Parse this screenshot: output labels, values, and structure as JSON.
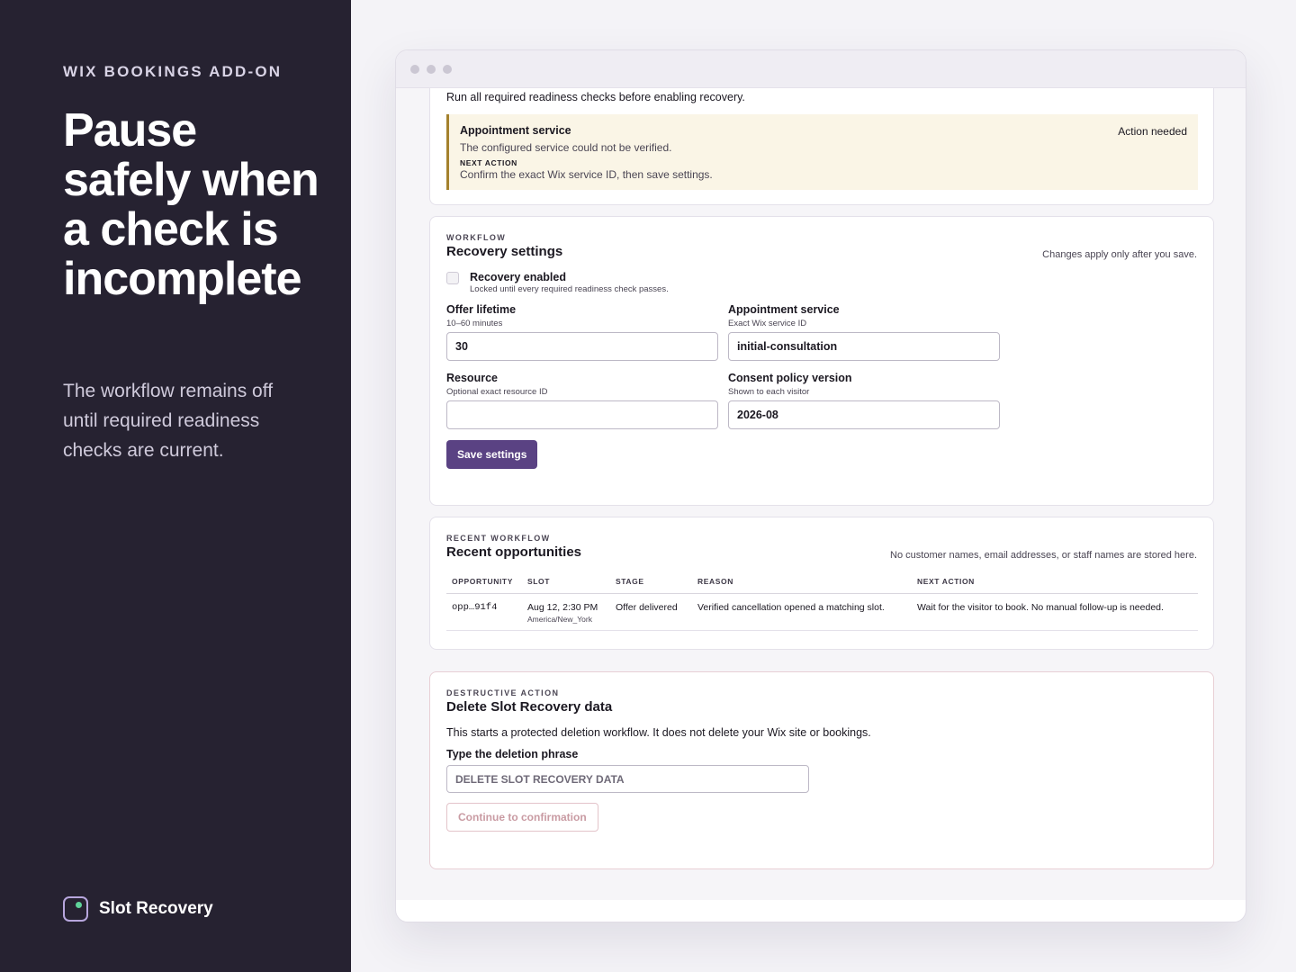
{
  "hero": {
    "eyebrow": "WIX BOOKINGS ADD-ON",
    "headline": "Pause safely when a check is incomplete",
    "subtext": "The workflow remains off until required readiness checks are current.",
    "brand_name": "Slot Recovery"
  },
  "readiness": {
    "intro": "Run all required readiness checks before enabling recovery.",
    "notice": {
      "title": "Appointment service",
      "status": "Action needed",
      "description": "The configured service could not be verified.",
      "next_label": "NEXT ACTION",
      "next_action": "Confirm the exact Wix service ID, then save settings."
    }
  },
  "settings": {
    "kicker": "WORKFLOW",
    "title": "Recovery settings",
    "note": "Changes apply only after you save.",
    "recovery_label": "Recovery enabled",
    "recovery_hint": "Locked until every required readiness check passes.",
    "offer_label": "Offer lifetime",
    "offer_hint": "10–60 minutes",
    "offer_value": "30",
    "appt_label": "Appointment service",
    "appt_hint": "Exact Wix service ID",
    "appt_value": "initial-consultation",
    "resource_label": "Resource",
    "resource_hint": "Optional exact resource ID",
    "resource_value": "",
    "consent_label": "Consent policy version",
    "consent_hint": "Shown to each visitor",
    "consent_value": "2026-08",
    "save_label": "Save settings"
  },
  "recent": {
    "kicker": "RECENT WORKFLOW",
    "title": "Recent opportunities",
    "note": "No customer names, email addresses, or staff names are stored here.",
    "columns": [
      "OPPORTUNITY",
      "SLOT",
      "STAGE",
      "REASON",
      "NEXT ACTION"
    ],
    "rows": [
      {
        "opportunity": "opp…91f4",
        "slot": "Aug 12, 2:30 PM",
        "timezone": "America/New_York",
        "stage": "Offer delivered",
        "reason": "Verified cancellation opened a matching slot.",
        "next_action": "Wait for the visitor to book. No manual follow-up is needed."
      }
    ]
  },
  "danger": {
    "kicker": "DESTRUCTIVE ACTION",
    "title": "Delete Slot Recovery data",
    "description": "This starts a protected deletion workflow. It does not delete your Wix site or bookings.",
    "phrase_label": "Type the deletion phrase",
    "phrase_placeholder": "DELETE SLOT RECOVERY DATA",
    "continue_label": "Continue to confirmation"
  }
}
